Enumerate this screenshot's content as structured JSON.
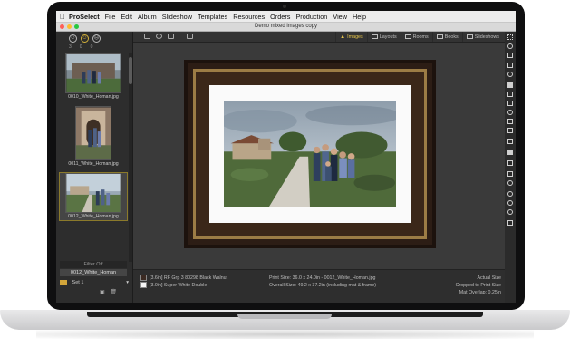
{
  "menubar": {
    "apple_icon": "apple-icon",
    "app_name": "ProSelect",
    "items": [
      "File",
      "Edit",
      "Album",
      "Slideshow",
      "Templates",
      "Resources",
      "Orders",
      "Production",
      "View",
      "Help"
    ]
  },
  "window": {
    "title": "Demo mixed images copy",
    "traffic_light_colors": [
      "#ff5f57",
      "#febc2e",
      "#28c840"
    ]
  },
  "left_panel": {
    "face_counts": [
      "3",
      "0",
      "0"
    ],
    "thumbnails": [
      {
        "filename": "0010_White_Homan.jpg",
        "selected": false
      },
      {
        "filename": "0011_White_Homan.jpg",
        "selected": false
      },
      {
        "filename": "0012_White_Homan.jpg",
        "selected": true
      }
    ],
    "filter_label": "Filter Off",
    "current_image": "0012_White_Homan",
    "set_label": "Set 1"
  },
  "toolbar": {
    "tabs": [
      {
        "label": "Images",
        "active": true
      },
      {
        "label": "Layouts",
        "active": false
      },
      {
        "label": "Rooms",
        "active": false
      },
      {
        "label": "Books",
        "active": false
      },
      {
        "label": "Slideshows",
        "active": false
      }
    ],
    "accent_color": "#e5c44b"
  },
  "info_bar": {
    "frame_line": "[3.6in] RF Grp 3  80298 Black Walnut",
    "mat_line": "[3.0in] Super White Double",
    "print_size": "Print Size: 36.0 x 24.0in - 0012_White_Homan.jpg",
    "overall_size": "Overall Size: 49.2 x 37.2in (including mat & frame)",
    "actual_size": "Actual Size",
    "cropped": "Cropped to Print Size",
    "mat_overlap": "Mat Overlap: 0.25in"
  }
}
